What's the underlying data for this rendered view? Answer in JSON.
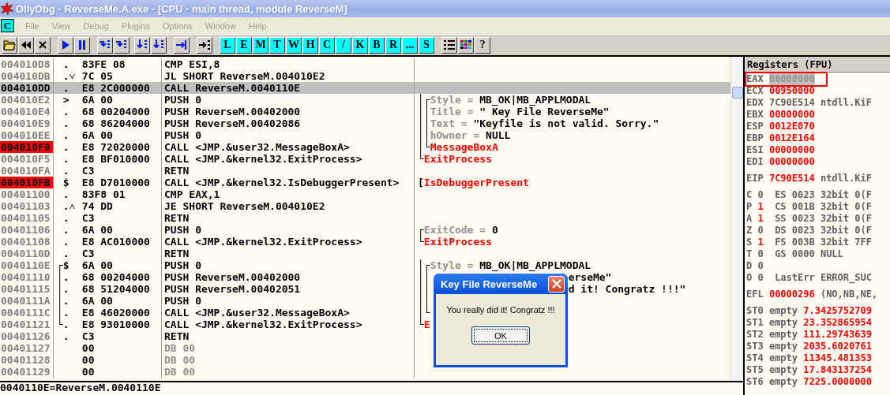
{
  "window": {
    "title": "OllyDbg - ReverseMe.A.exe - [CPU - main thread, module ReverseM]"
  },
  "menu": {
    "child_icon": "C",
    "items": [
      {
        "label": "File",
        "disabled": true
      },
      {
        "label": "View",
        "disabled": true
      },
      {
        "label": "Debug",
        "disabled": true
      },
      {
        "label": "Plugins",
        "disabled": true
      },
      {
        "label": "Options",
        "disabled": true
      },
      {
        "label": "Window",
        "disabled": true
      },
      {
        "label": "Help",
        "disabled": true
      }
    ]
  },
  "toolbar": {
    "letters": [
      "L",
      "E",
      "M",
      "T",
      "W",
      "H",
      "C",
      "/",
      "K",
      "B",
      "R",
      "...",
      "S"
    ],
    "help": "?"
  },
  "disassembly": {
    "rows": [
      {
        "address": "004010D8",
        "mark": ".",
        "hex": "83FE 08",
        "asm": "CMP ESI,8",
        "selected": false,
        "breakpoint": false
      },
      {
        "address": "004010DB",
        "mark": ".˅",
        "hex": "7C 05",
        "asm": "JL SHORT ReverseM.004010E2",
        "selected": false,
        "breakpoint": false
      },
      {
        "address": "004010DD",
        "mark": ".",
        "hex": "E8 2C000000",
        "asm": "CALL ReverseM.0040110E",
        "selected": true,
        "breakpoint": false
      },
      {
        "address": "004010E2",
        "mark": ">",
        "hex": "6A 00",
        "asm": "PUSH 0",
        "selected": false,
        "breakpoint": false,
        "comment": {
          "brackets": "│┌",
          "kind": "param",
          "label": "Style =",
          "value": "MB_OK|MB_APPLMODAL"
        }
      },
      {
        "address": "004010E4",
        "mark": ".",
        "hex": "68 00204000",
        "asm": "PUSH ReverseM.00402000",
        "selected": false,
        "breakpoint": false,
        "comment": {
          "brackets": "││",
          "kind": "param",
          "label": "Title =",
          "value": "\" Key File ReverseMe\""
        }
      },
      {
        "address": "004010E9",
        "mark": ".",
        "hex": "68 86204000",
        "asm": "PUSH ReverseM.00402086",
        "selected": false,
        "breakpoint": false,
        "comment": {
          "brackets": "││",
          "kind": "param",
          "label": "Text =",
          "value": "\"Keyfile is not valid. Sorry.\""
        }
      },
      {
        "address": "004010EE",
        "mark": ".",
        "hex": "6A 00",
        "asm": "PUSH 0",
        "selected": false,
        "breakpoint": false,
        "comment": {
          "brackets": "││",
          "kind": "param",
          "label": "hOwner =",
          "value": "NULL"
        }
      },
      {
        "address": "004010F0",
        "mark": ".",
        "hex": "E8 72020000",
        "asm": "CALL <JMP.&user32.MessageBoxA>",
        "selected": false,
        "breakpoint": true,
        "comment": {
          "brackets": "│└",
          "kind": "call",
          "text": "MessageBoxA"
        }
      },
      {
        "address": "004010F5",
        "mark": ".",
        "hex": "E8 BF010000",
        "asm": "CALL <JMP.&kernel32.ExitProcess>",
        "selected": false,
        "breakpoint": false,
        "comment": {
          "brackets": "└",
          "kind": "call",
          "text": "ExitProcess"
        }
      },
      {
        "address": "004010FA",
        "mark": ".",
        "hex": "C3",
        "asm": "RETN",
        "selected": false,
        "breakpoint": false
      },
      {
        "address": "004010FB",
        "mark": "$",
        "hex": "E8 D7010000",
        "asm": "CALL <JMP.&kernel32.IsDebuggerPresent>",
        "selected": false,
        "breakpoint": true,
        "comment": {
          "brackets": "[",
          "kind": "call",
          "text": "IsDebuggerPresent"
        }
      },
      {
        "address": "00401100",
        "mark": ".",
        "hex": "83F8 01",
        "asm": "CMP EAX,1",
        "selected": false,
        "breakpoint": false
      },
      {
        "address": "00401103",
        "mark": ".˄",
        "hex": "74 DD",
        "asm": "JE SHORT ReverseM.004010E2",
        "selected": false,
        "breakpoint": false
      },
      {
        "address": "00401105",
        "mark": ".",
        "hex": "C3",
        "asm": "RETN",
        "selected": false,
        "breakpoint": false
      },
      {
        "address": "00401106",
        "mark": ".",
        "hex": "6A 00",
        "asm": "PUSH 0",
        "selected": false,
        "breakpoint": false,
        "comment": {
          "brackets": "┌",
          "kind": "param",
          "label": "ExitCode =",
          "value": "0"
        }
      },
      {
        "address": "00401108",
        "mark": ".",
        "hex": "E8 AC010000",
        "asm": "CALL <JMP.&kernel32.ExitProcess>",
        "selected": false,
        "breakpoint": false,
        "comment": {
          "brackets": "└",
          "kind": "call",
          "text": "ExitProcess"
        }
      },
      {
        "address": "0040110D",
        "mark": ".",
        "hex": "C3",
        "asm": "RETN",
        "selected": false,
        "breakpoint": false
      },
      {
        "address": "0040110E",
        "flow": "┌",
        "mark": "$",
        "hex": "6A 00",
        "asm": "PUSH 0",
        "selected": false,
        "breakpoint": false,
        "comment": {
          "brackets": "│┌",
          "kind": "param",
          "label": "Style =",
          "value": "MB_OK|MB_APPLMODAL"
        }
      },
      {
        "address": "00401110",
        "flow": "│",
        "mark": ".",
        "hex": "68 00204000",
        "asm": "PUSH ReverseM.00402000",
        "selected": false,
        "breakpoint": false,
        "comment": {
          "brackets": "││",
          "kind": "tail",
          "text": "erseMe\""
        }
      },
      {
        "address": "00401115",
        "flow": "│",
        "mark": ".",
        "hex": "68 51204000",
        "asm": "PUSH ReverseM.00402051",
        "selected": false,
        "breakpoint": false,
        "comment": {
          "brackets": "││",
          "kind": "tail",
          "text": "d it! Congratz !!!\""
        }
      },
      {
        "address": "0040111A",
        "flow": "│",
        "mark": ".",
        "hex": "6A 00",
        "asm": "PUSH 0",
        "selected": false,
        "breakpoint": false,
        "comment": {
          "brackets": "││"
        }
      },
      {
        "address": "0040111C",
        "flow": "│",
        "mark": ".",
        "hex": "E8 46020000",
        "asm": "CALL <JMP.&user32.MessageBoxA>",
        "selected": false,
        "breakpoint": false,
        "comment": {
          "brackets": "│└"
        }
      },
      {
        "address": "00401121",
        "flow": "└",
        "mark": ".",
        "hex": "E8 93010000",
        "asm": "CALL <JMP.&kernel32.ExitProcess>",
        "selected": false,
        "breakpoint": false,
        "comment": {
          "brackets": "└",
          "kind": "call",
          "text": "E"
        }
      },
      {
        "address": "00401126",
        "mark": ".",
        "hex": "C3",
        "asm": "RETN",
        "selected": false,
        "breakpoint": false
      },
      {
        "address": "00401127",
        "hex": "00",
        "asm": "DB 00",
        "data": true,
        "selected": false,
        "breakpoint": false
      },
      {
        "address": "00401128",
        "hex": "00",
        "asm": "DB 00",
        "data": true,
        "selected": false,
        "breakpoint": false
      },
      {
        "address": "00401129",
        "hex": "00",
        "asm": "DB 00",
        "data": true,
        "selected": false,
        "breakpoint": false
      }
    ],
    "status": "0040110E=ReverseM.0040110E"
  },
  "registers": {
    "title": "Registers (FPU)",
    "general": [
      {
        "name": "EAX",
        "value": "00000000",
        "changed": false,
        "selected": true,
        "highlighted": true
      },
      {
        "name": "ECX",
        "value": "00950000",
        "changed": true,
        "selected": false,
        "highlighted": false
      },
      {
        "name": "EDX",
        "value": "7C90E514",
        "changed": false,
        "selected": false,
        "highlighted": false,
        "note": "ntdll.KiF"
      },
      {
        "name": "EBX",
        "value": "00000000",
        "changed": true,
        "selected": false,
        "highlighted": false
      },
      {
        "name": "ESP",
        "value": "0012E070",
        "changed": true,
        "selected": false,
        "highlighted": false
      },
      {
        "name": "EBP",
        "value": "0012E164",
        "changed": true,
        "selected": false,
        "highlighted": false
      },
      {
        "name": "ESI",
        "value": "00000000",
        "changed": true,
        "selected": false,
        "highlighted": false
      },
      {
        "name": "EDI",
        "value": "00000000",
        "changed": true,
        "selected": false,
        "highlighted": false
      }
    ],
    "eip": [
      {
        "name": "EIP",
        "value": "7C90E514",
        "changed": true,
        "selected": false,
        "highlighted": false,
        "note": "ntdll.KiF"
      }
    ],
    "flags": [
      {
        "flag": "C",
        "bit": "0",
        "changed": false,
        "segment": "ES",
        "selector": "0023",
        "info": "32bit 0(F"
      },
      {
        "flag": "P",
        "bit": "1",
        "changed": true,
        "segment": "CS",
        "selector": "001B",
        "info": "32bit 0(F"
      },
      {
        "flag": "A",
        "bit": "1",
        "changed": true,
        "segment": "SS",
        "selector": "0023",
        "info": "32bit 0(F"
      },
      {
        "flag": "Z",
        "bit": "0",
        "changed": false,
        "segment": "DS",
        "selector": "0023",
        "info": "32bit 0(F"
      },
      {
        "flag": "S",
        "bit": "1",
        "changed": true,
        "segment": "FS",
        "selector": "003B",
        "info": "32bit 7FF"
      },
      {
        "flag": "T",
        "bit": "0",
        "changed": false,
        "segment": "GS",
        "selector": "0000",
        "info": "NULL"
      },
      {
        "flag": "D",
        "bit": "0",
        "changed": false
      },
      {
        "flag": "O",
        "bit": "0",
        "changed": false,
        "segment": "LastErr",
        "info": "ERROR_SUC"
      }
    ],
    "efl": [
      {
        "name": "EFL",
        "value": "00000296",
        "changed": true,
        "selected": false,
        "highlighted": false,
        "note": "(NO,NB,NE,"
      }
    ],
    "fpu": [
      {
        "name": "ST0",
        "tag": "empty",
        "value": "7.3425752709",
        "changed": true
      },
      {
        "name": "ST1",
        "tag": "empty",
        "value": "23.352865954",
        "changed": true
      },
      {
        "name": "ST2",
        "tag": "empty",
        "value": "111.29743639",
        "changed": true
      },
      {
        "name": "ST3",
        "tag": "empty",
        "value": "2035.6020761",
        "changed": true
      },
      {
        "name": "ST4",
        "tag": "empty",
        "value": "11345.481353",
        "changed": true
      },
      {
        "name": "ST5",
        "tag": "empty",
        "value": "17.843137254",
        "changed": true
      },
      {
        "name": "ST6",
        "tag": "empty",
        "value": "7225.0000000",
        "changed": true
      }
    ]
  },
  "dialog": {
    "title": "Key File ReverseMe",
    "message": "You really did it! Congratz !!!",
    "button": "OK"
  }
}
